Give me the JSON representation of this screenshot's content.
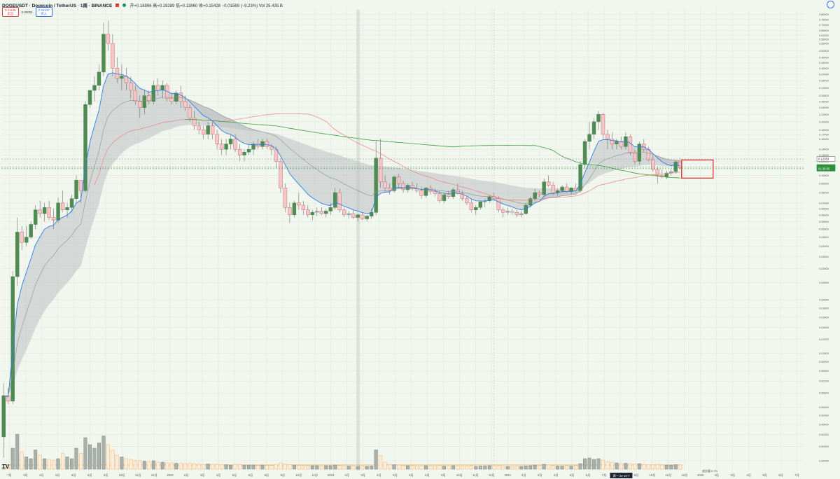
{
  "header": {
    "symbol": "DOGEUSDT · Dogecoin / TetherUS · 1周 · BINANCE",
    "ohlc": "开=0.16996  高=0.19289  低=0.13860  收=0.15428  −0.01569 (−9.23%)  Vol 25.435 B"
  },
  "trade": {
    "sell_price": "0.11136",
    "sell_label": "卖出",
    "spread": "0.00001",
    "buy_price": "0.11137",
    "buy_label": "买入"
  },
  "colors": {
    "background": "#f1f6ee",
    "candle_up": "#4e8a52",
    "candle_down": "#d2676b",
    "candle_neutral": "#9aa0a6",
    "ema_fast": "#2f7ee6",
    "band_fill": "#b7bcc0",
    "ma_long_green": "#3aa03a",
    "ma_long_red": "#f08080",
    "highlight_box": "#e03030",
    "volume_orange": "#f0a040"
  },
  "chart_data": {
    "type": "candlestick",
    "interval": "1W",
    "y_scale": "log",
    "ylim": [
      0.0022,
      0.85
    ],
    "y_ticks": [
      "0.80000",
      "0.75000",
      "0.70000",
      "0.65000",
      "0.61000",
      "0.58000",
      "0.55000",
      "0.50000",
      "0.46000",
      "0.43000",
      "0.40000",
      "0.37000",
      "0.34000",
      "0.31000",
      "0.28000",
      "0.26000",
      "0.24000",
      "0.22000",
      "0.20000",
      "0.18000",
      "0.17000",
      "0.16000",
      "0.14000",
      "0.13000",
      "0.12000",
      "0.11000",
      "0.10000",
      "0.09000",
      "0.08000",
      "0.07000",
      "0.06500",
      "0.06000",
      "0.05500",
      "0.05000",
      "0.04500",
      "0.04000",
      "0.03500",
      "0.03000",
      "0.02500",
      "0.02000",
      "0.01800",
      "0.01600",
      "0.01400",
      "0.01200",
      "0.01000",
      "0.00900",
      "0.00800",
      "0.00700",
      "0.00600",
      "0.00500",
      "0.00450",
      "0.00400",
      "0.00350",
      "0.00300",
      "0.00250"
    ],
    "price_tags": [
      {
        "value": 0.12353,
        "label": "0.12353",
        "style": "outline"
      },
      {
        "value": 0.11138,
        "label": "0.11138",
        "style": "green"
      },
      {
        "value": 0.109,
        "label": "01:35:55",
        "style": "green-sub"
      }
    ],
    "x_labels": [
      "7月",
      "3月",
      "4月",
      "5月",
      "6月",
      "8月",
      "9月",
      "10月",
      "11月",
      "12月",
      "2022",
      "2月",
      "3月",
      "4月",
      "5月",
      "6月",
      "8月",
      "9月",
      "10月",
      "11月",
      "2023",
      "2月",
      "3月",
      "4月",
      "5月",
      "6月",
      "8月",
      "9月",
      "10月",
      "11月",
      "12月",
      "2024",
      "2月",
      "3月",
      "4月",
      "5月",
      "6月",
      "7月",
      "8月",
      "9月",
      "10月",
      "11月",
      "12月",
      "2025",
      "2月",
      "3月",
      "4月",
      "5月",
      "6月",
      "7月"
    ],
    "current_time_label": "周一 24-10-7",
    "x_axis_note": "成交量  0.7%",
    "ohlc": [
      [
        0.0034,
        0.0068,
        0.0026,
        0.0058
      ],
      [
        0.0058,
        0.0064,
        0.0052,
        0.0054
      ],
      [
        0.0054,
        0.029,
        0.0052,
        0.027
      ],
      [
        0.027,
        0.058,
        0.024,
        0.048
      ],
      [
        0.048,
        0.052,
        0.038,
        0.042
      ],
      [
        0.042,
        0.052,
        0.04,
        0.045
      ],
      [
        0.045,
        0.055,
        0.044,
        0.053
      ],
      [
        0.053,
        0.068,
        0.05,
        0.064
      ],
      [
        0.064,
        0.072,
        0.058,
        0.061
      ],
      [
        0.061,
        0.07,
        0.055,
        0.066
      ],
      [
        0.066,
        0.072,
        0.056,
        0.058
      ],
      [
        0.058,
        0.065,
        0.05,
        0.056
      ],
      [
        0.056,
        0.075,
        0.054,
        0.07
      ],
      [
        0.07,
        0.082,
        0.062,
        0.064
      ],
      [
        0.064,
        0.07,
        0.058,
        0.066
      ],
      [
        0.066,
        0.078,
        0.062,
        0.074
      ],
      [
        0.074,
        0.1,
        0.07,
        0.094
      ],
      [
        0.094,
        0.09,
        0.07,
        0.082
      ],
      [
        0.082,
        0.26,
        0.08,
        0.25
      ],
      [
        0.25,
        0.3,
        0.24,
        0.3
      ],
      [
        0.3,
        0.36,
        0.26,
        0.32
      ],
      [
        0.32,
        0.42,
        0.3,
        0.38
      ],
      [
        0.38,
        0.72,
        0.36,
        0.62
      ],
      [
        0.62,
        0.74,
        0.5,
        0.55
      ],
      [
        0.55,
        0.62,
        0.36,
        0.4
      ],
      [
        0.4,
        0.46,
        0.33,
        0.35
      ],
      [
        0.35,
        0.42,
        0.3,
        0.36
      ],
      [
        0.36,
        0.4,
        0.3,
        0.33
      ],
      [
        0.33,
        0.36,
        0.27,
        0.3
      ],
      [
        0.3,
        0.32,
        0.25,
        0.26
      ],
      [
        0.26,
        0.28,
        0.21,
        0.24
      ],
      [
        0.24,
        0.3,
        0.22,
        0.28
      ],
      [
        0.28,
        0.3,
        0.25,
        0.26
      ],
      [
        0.26,
        0.34,
        0.25,
        0.32
      ],
      [
        0.32,
        0.35,
        0.28,
        0.3
      ],
      [
        0.3,
        0.34,
        0.27,
        0.32
      ],
      [
        0.32,
        0.33,
        0.26,
        0.27
      ],
      [
        0.27,
        0.29,
        0.25,
        0.26
      ],
      [
        0.26,
        0.3,
        0.25,
        0.29
      ],
      [
        0.29,
        0.32,
        0.24,
        0.26
      ],
      [
        0.26,
        0.28,
        0.23,
        0.24
      ],
      [
        0.24,
        0.25,
        0.2,
        0.21
      ],
      [
        0.21,
        0.23,
        0.18,
        0.19
      ],
      [
        0.19,
        0.2,
        0.17,
        0.18
      ],
      [
        0.18,
        0.19,
        0.16,
        0.17
      ],
      [
        0.17,
        0.2,
        0.16,
        0.19
      ],
      [
        0.19,
        0.2,
        0.16,
        0.17
      ],
      [
        0.17,
        0.18,
        0.14,
        0.15
      ],
      [
        0.15,
        0.16,
        0.13,
        0.14
      ],
      [
        0.14,
        0.16,
        0.13,
        0.15
      ],
      [
        0.15,
        0.17,
        0.14,
        0.16
      ],
      [
        0.16,
        0.17,
        0.135,
        0.14
      ],
      [
        0.14,
        0.15,
        0.12,
        0.13
      ],
      [
        0.13,
        0.14,
        0.12,
        0.135
      ],
      [
        0.135,
        0.15,
        0.13,
        0.14
      ],
      [
        0.14,
        0.155,
        0.13,
        0.15
      ],
      [
        0.15,
        0.16,
        0.14,
        0.145
      ],
      [
        0.145,
        0.16,
        0.14,
        0.155
      ],
      [
        0.155,
        0.16,
        0.14,
        0.145
      ],
      [
        0.145,
        0.15,
        0.13,
        0.14
      ],
      [
        0.14,
        0.145,
        0.11,
        0.12
      ],
      [
        0.12,
        0.125,
        0.08,
        0.085
      ],
      [
        0.085,
        0.09,
        0.062,
        0.066
      ],
      [
        0.066,
        0.07,
        0.054,
        0.06
      ],
      [
        0.06,
        0.072,
        0.058,
        0.07
      ],
      [
        0.07,
        0.08,
        0.064,
        0.068
      ],
      [
        0.068,
        0.072,
        0.06,
        0.064
      ],
      [
        0.064,
        0.068,
        0.058,
        0.06
      ],
      [
        0.06,
        0.064,
        0.056,
        0.062
      ],
      [
        0.062,
        0.066,
        0.059,
        0.063
      ],
      [
        0.063,
        0.066,
        0.06,
        0.061
      ],
      [
        0.061,
        0.065,
        0.058,
        0.063
      ],
      [
        0.063,
        0.07,
        0.06,
        0.066
      ],
      [
        0.066,
        0.085,
        0.064,
        0.08
      ],
      [
        0.08,
        0.084,
        0.062,
        0.064
      ],
      [
        0.064,
        0.066,
        0.058,
        0.06
      ],
      [
        0.06,
        0.063,
        0.057,
        0.061
      ],
      [
        0.061,
        0.064,
        0.057,
        0.058
      ],
      [
        0.058,
        0.061,
        0.055,
        0.06
      ],
      [
        0.06,
        0.062,
        0.056,
        0.057
      ],
      [
        0.057,
        0.06,
        0.055,
        0.059
      ],
      [
        0.059,
        0.065,
        0.057,
        0.062
      ],
      [
        0.062,
        0.155,
        0.06,
        0.125
      ],
      [
        0.125,
        0.16,
        0.085,
        0.092
      ],
      [
        0.092,
        0.1,
        0.08,
        0.085
      ],
      [
        0.085,
        0.09,
        0.078,
        0.082
      ],
      [
        0.082,
        0.1,
        0.08,
        0.098
      ],
      [
        0.098,
        0.102,
        0.086,
        0.09
      ],
      [
        0.09,
        0.093,
        0.08,
        0.083
      ],
      [
        0.083,
        0.09,
        0.08,
        0.088
      ],
      [
        0.088,
        0.092,
        0.082,
        0.084
      ],
      [
        0.084,
        0.09,
        0.08,
        0.082
      ],
      [
        0.082,
        0.086,
        0.074,
        0.077
      ],
      [
        0.077,
        0.086,
        0.075,
        0.085
      ],
      [
        0.085,
        0.088,
        0.078,
        0.081
      ],
      [
        0.081,
        0.084,
        0.076,
        0.079
      ],
      [
        0.079,
        0.082,
        0.07,
        0.072
      ],
      [
        0.072,
        0.08,
        0.07,
        0.078
      ],
      [
        0.078,
        0.082,
        0.074,
        0.076
      ],
      [
        0.076,
        0.085,
        0.074,
        0.083
      ],
      [
        0.083,
        0.09,
        0.078,
        0.079
      ],
      [
        0.079,
        0.082,
        0.072,
        0.074
      ],
      [
        0.074,
        0.076,
        0.068,
        0.07
      ],
      [
        0.07,
        0.074,
        0.062,
        0.064
      ],
      [
        0.064,
        0.068,
        0.06,
        0.066
      ],
      [
        0.066,
        0.072,
        0.064,
        0.071
      ],
      [
        0.071,
        0.074,
        0.066,
        0.072
      ],
      [
        0.072,
        0.078,
        0.07,
        0.076
      ],
      [
        0.076,
        0.08,
        0.072,
        0.074
      ],
      [
        0.074,
        0.076,
        0.062,
        0.064
      ],
      [
        0.064,
        0.066,
        0.058,
        0.062
      ],
      [
        0.062,
        0.066,
        0.06,
        0.063
      ],
      [
        0.063,
        0.065,
        0.06,
        0.062
      ],
      [
        0.062,
        0.064,
        0.058,
        0.06
      ],
      [
        0.06,
        0.063,
        0.058,
        0.061
      ],
      [
        0.061,
        0.07,
        0.06,
        0.068
      ],
      [
        0.068,
        0.076,
        0.066,
        0.074
      ],
      [
        0.074,
        0.084,
        0.072,
        0.08
      ],
      [
        0.08,
        0.082,
        0.075,
        0.078
      ],
      [
        0.078,
        0.096,
        0.076,
        0.092
      ],
      [
        0.092,
        0.1,
        0.086,
        0.088
      ],
      [
        0.088,
        0.092,
        0.078,
        0.08
      ],
      [
        0.08,
        0.084,
        0.077,
        0.082
      ],
      [
        0.082,
        0.088,
        0.08,
        0.086
      ],
      [
        0.086,
        0.09,
        0.08,
        0.081
      ],
      [
        0.081,
        0.086,
        0.078,
        0.085
      ],
      [
        0.085,
        0.09,
        0.08,
        0.082
      ],
      [
        0.082,
        0.12,
        0.08,
        0.115
      ],
      [
        0.115,
        0.16,
        0.11,
        0.155
      ],
      [
        0.155,
        0.2,
        0.14,
        0.17
      ],
      [
        0.17,
        0.21,
        0.16,
        0.2
      ],
      [
        0.2,
        0.23,
        0.18,
        0.22
      ],
      [
        0.22,
        0.225,
        0.16,
        0.17
      ],
      [
        0.17,
        0.18,
        0.14,
        0.16
      ],
      [
        0.16,
        0.175,
        0.14,
        0.15
      ],
      [
        0.15,
        0.16,
        0.14,
        0.155
      ],
      [
        0.155,
        0.165,
        0.14,
        0.145
      ],
      [
        0.145,
        0.175,
        0.14,
        0.165
      ],
      [
        0.165,
        0.17,
        0.13,
        0.135
      ],
      [
        0.135,
        0.14,
        0.115,
        0.12
      ],
      [
        0.12,
        0.155,
        0.115,
        0.15
      ],
      [
        0.15,
        0.16,
        0.135,
        0.14
      ],
      [
        0.14,
        0.145,
        0.12,
        0.122
      ],
      [
        0.122,
        0.13,
        0.105,
        0.108
      ],
      [
        0.108,
        0.112,
        0.09,
        0.1
      ],
      [
        0.1,
        0.108,
        0.096,
        0.098
      ],
      [
        0.098,
        0.106,
        0.095,
        0.103
      ],
      [
        0.103,
        0.108,
        0.1,
        0.105
      ],
      [
        0.105,
        0.122,
        0.102,
        0.119
      ],
      [
        0.119,
        0.125,
        0.108,
        0.11
      ]
    ],
    "volume": [
      0.05,
      0.04,
      0.6,
      1.0,
      0.5,
      0.35,
      0.3,
      0.55,
      0.4,
      0.3,
      0.28,
      0.26,
      0.3,
      0.45,
      0.35,
      0.3,
      0.6,
      0.45,
      0.9,
      0.7,
      0.6,
      0.75,
      0.95,
      0.7,
      0.55,
      0.4,
      0.35,
      0.3,
      0.28,
      0.25,
      0.24,
      0.23,
      0.22,
      0.24,
      0.2,
      0.2,
      0.18,
      0.18,
      0.17,
      0.17,
      0.16,
      0.18,
      0.16,
      0.15,
      0.14,
      0.15,
      0.14,
      0.14,
      0.13,
      0.13,
      0.12,
      0.14,
      0.14,
      0.12,
      0.12,
      0.12,
      0.11,
      0.12,
      0.11,
      0.11,
      0.14,
      0.18,
      0.15,
      0.13,
      0.12,
      0.11,
      0.1,
      0.1,
      0.1,
      0.1,
      0.09,
      0.1,
      0.1,
      0.12,
      0.11,
      0.09,
      0.09,
      0.09,
      0.08,
      0.09,
      0.08,
      0.09,
      0.55,
      0.4,
      0.2,
      0.14,
      0.13,
      0.12,
      0.1,
      0.1,
      0.1,
      0.09,
      0.09,
      0.1,
      0.09,
      0.09,
      0.1,
      0.09,
      0.09,
      0.1,
      0.09,
      0.09,
      0.09,
      0.1,
      0.08,
      0.09,
      0.09,
      0.1,
      0.09,
      0.1,
      0.08,
      0.08,
      0.08,
      0.08,
      0.08,
      0.09,
      0.1,
      0.12,
      0.1,
      0.14,
      0.12,
      0.1,
      0.09,
      0.09,
      0.1,
      0.09,
      0.1,
      0.16,
      0.3,
      0.32,
      0.28,
      0.3,
      0.26,
      0.22,
      0.2,
      0.18,
      0.16,
      0.17,
      0.16,
      0.15,
      0.16,
      0.14,
      0.13,
      0.13,
      0.14,
      0.12,
      0.12,
      0.12,
      0.13,
      0.12
    ]
  }
}
